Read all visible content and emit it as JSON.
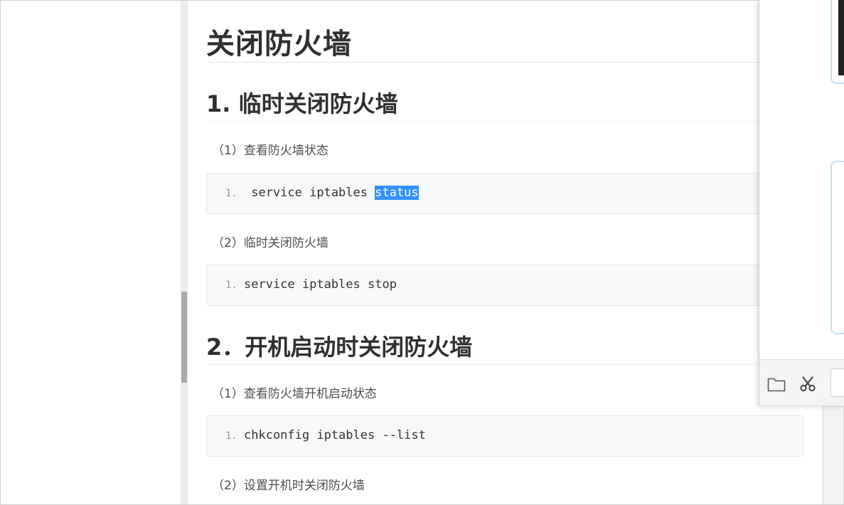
{
  "article": {
    "title": "关闭防火墙",
    "section1": {
      "heading": "1. 临时关闭防火墙",
      "step1": "（1）查看防火墙状态",
      "code1": {
        "line_no": "1.",
        "before_sel": " service iptables ",
        "selected": "status"
      },
      "step2": "（2）临时关闭防火墙",
      "code2": {
        "line_no": "1.",
        "text": "service iptables stop"
      }
    },
    "section2": {
      "heading": "2．开机启动时关闭防火墙",
      "step1": "（1）查看防火墙开机启动状态",
      "code1": {
        "line_no": "1.",
        "text": "chkconfig iptables --list"
      },
      "step2": "（2）设置开机时关闭防火墙"
    }
  },
  "panel": {
    "toolbar": [
      {
        "icon": "folder-icon"
      },
      {
        "icon": "scissors-icon"
      }
    ]
  },
  "colors": {
    "selection": "#3390ff",
    "code_bg": "#f6f8fa",
    "card_border": "#bfe0f2"
  }
}
